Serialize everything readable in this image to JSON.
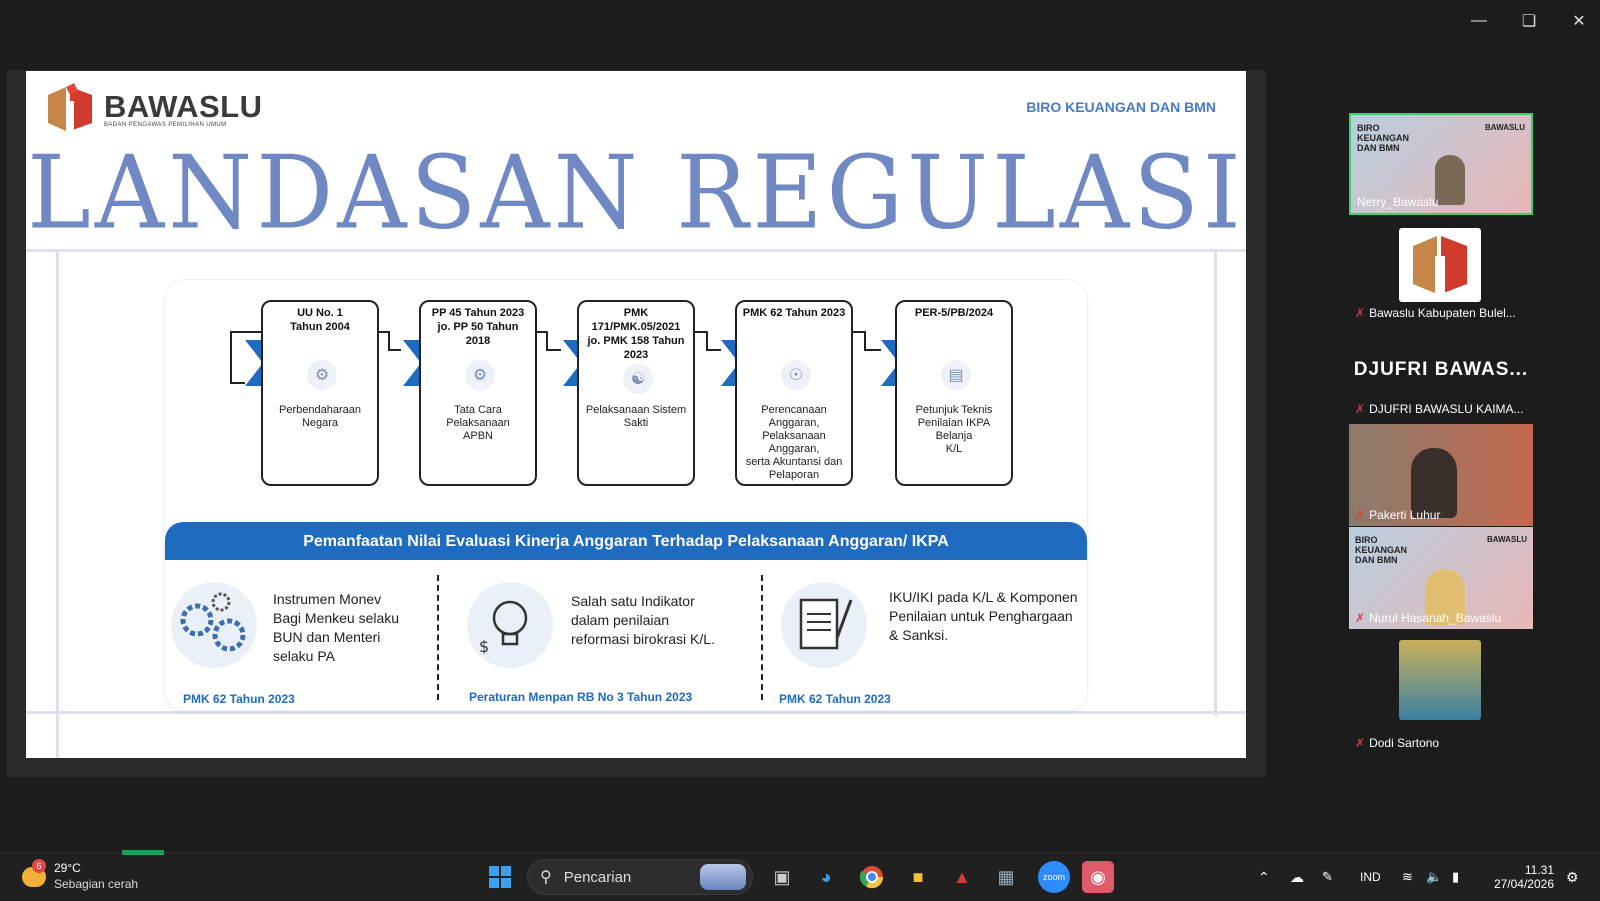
{
  "window": {
    "controls": [
      "minimize",
      "restore",
      "close"
    ]
  },
  "slide": {
    "logo_name": "BAWASLU",
    "logo_sub": "BADAN PENGAWAS PEMILIHAN UMUM",
    "header_right": "BIRO KEUANGAN DAN BMN",
    "title": "LANDASAN REGULASI",
    "flow": [
      {
        "head": "UU No. 1\nTahun 2004",
        "desc": "Perbendaharaan\nNegara",
        "icon": "puzzle-gear-icon"
      },
      {
        "head": "PP 45 Tahun 2023\njo. PP 50 Tahun\n2018",
        "desc": "Tata Cara Pelaksanaan\nAPBN",
        "icon": "gears-icon"
      },
      {
        "head": "PMK\n171/PMK.05/2021\njo. PMK 158 Tahun\n2023",
        "desc": "Pelaksanaan Sistem\nSakti",
        "icon": "network-icon"
      },
      {
        "head": "PMK 62 Tahun 2023",
        "desc": "Perencanaan Anggaran,\nPelaksanaan Anggaran,\nserta Akuntansi dan\nPelaporan",
        "icon": "lightbulb-icon"
      },
      {
        "head": "PER-5/PB/2024",
        "desc": "Petunjuk Teknis\nPenilaian IKPA Belanja\nK/L",
        "icon": "clipboard-icon"
      }
    ],
    "banner": "Pemanfaatan Nilai Evaluasi Kinerja Anggaran Terhadap Pelaksanaan Anggaran/ IKPA",
    "evaluations": [
      {
        "text": "Instrumen Monev\nBagi Menkeu selaku\nBUN dan Menteri\nselaku PA",
        "ref": "PMK 62 Tahun 2023",
        "icon": "gears-icon"
      },
      {
        "text": "Salah satu Indikator\ndalam penilaian\nreformasi birokrasi K/L.",
        "ref": "Peraturan Menpan RB No 3 Tahun 2023",
        "icon": "lightbulb-dollar-icon"
      },
      {
        "text": "IKU/IKI pada K/L & Komponen\nPenilaian untuk Penghargaan\n& Sanksi.",
        "ref": "PMK 62 Tahun 2023",
        "icon": "notepad-pen-icon"
      }
    ]
  },
  "participants": [
    {
      "name": "Nerry_Bawaslu",
      "muted": false,
      "thumb_text": "BIRO\nKEUANGAN\nDAN BMN",
      "thumb_brand": "BAWASLU"
    },
    {
      "name": "Bawaslu Kabupaten Bulel...",
      "muted": true
    },
    {
      "name_card": "DJUFRI  BAWAS...",
      "name": "DJUFRI BAWASLU KAIMA...",
      "muted": true
    },
    {
      "name": "Pakerti Luhur",
      "muted": true
    },
    {
      "name": "Nurul Hasanah_Bawaslu",
      "muted": true,
      "thumb_text": "BIRO\nKEUANGAN\nDAN BMN",
      "thumb_brand": "BAWASLU"
    },
    {
      "name": "Dodi Sartono",
      "muted": true
    }
  ],
  "taskbar": {
    "weather_temp": "29°C",
    "weather_desc": "Sebagian cerah",
    "weather_badge": "6",
    "search_placeholder": "Pencarian",
    "language": "IND",
    "time": "11.31",
    "date": "27/04/2026"
  }
}
